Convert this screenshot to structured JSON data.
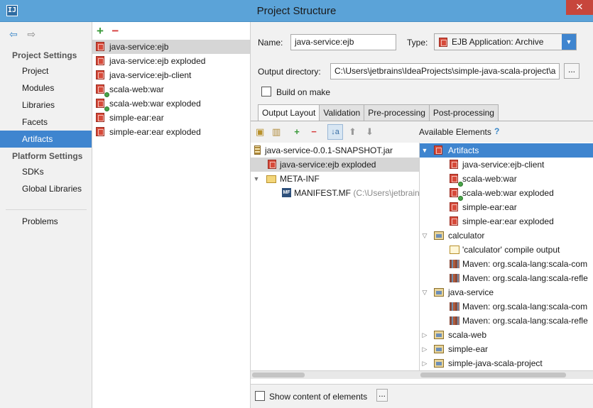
{
  "window": {
    "title": "Project Structure",
    "app_icon": "IJ",
    "close_glyph": "✕"
  },
  "nav": {
    "back_glyph": "⇦",
    "forward_glyph": "⇨",
    "project_settings_header": "Project Settings",
    "project_items": [
      "Project",
      "Modules",
      "Libraries",
      "Facets",
      "Artifacts"
    ],
    "platform_settings_header": "Platform Settings",
    "platform_items": [
      "SDKs",
      "Global Libraries"
    ],
    "problems": "Problems",
    "selected": "Artifacts"
  },
  "artifacts_list": {
    "add_glyph": "+",
    "remove_glyph": "−",
    "items": [
      {
        "label": "java-service:ejb",
        "icon": "ejb-jar-icon",
        "selected": true
      },
      {
        "label": "java-service:ejb exploded",
        "icon": "ejb-jar-icon"
      },
      {
        "label": "java-service:ejb-client",
        "icon": "ejb-jar-icon"
      },
      {
        "label": "scala-web:war",
        "icon": "war-icon"
      },
      {
        "label": "scala-web:war exploded",
        "icon": "war-icon"
      },
      {
        "label": "simple-ear:ear",
        "icon": "ear-icon"
      },
      {
        "label": "simple-ear:ear exploded",
        "icon": "ear-icon"
      }
    ]
  },
  "form": {
    "name_label": "Name:",
    "name_value": "java-service:ejb",
    "type_label": "Type:",
    "type_value": "EJB Application: Archive",
    "output_dir_label": "Output directory:",
    "output_dir_value": "C:\\Users\\jetbrains\\IdeaProjects\\simple-java-scala-project\\a",
    "browse_glyph": "...",
    "build_on_make_label": "Build on make",
    "build_on_make_checked": false
  },
  "tabs": [
    {
      "label": "Output Layout",
      "active": true
    },
    {
      "label": "Validation"
    },
    {
      "label": "Pre-processing"
    },
    {
      "label": "Post-processing"
    }
  ],
  "layout_toolbar": {
    "add_glyph": "+",
    "remove_glyph": "−",
    "sort_glyph": "↓a",
    "up_glyph": "⬆",
    "down_glyph": "⬇"
  },
  "output_tree": [
    {
      "label": "java-service-0.0.1-SNAPSHOT.jar",
      "icon": "jar-file-icon",
      "twisty": ""
    },
    {
      "label": "java-service:ejb exploded",
      "icon": "ejb-jar-icon",
      "twisty": "",
      "selected": true
    },
    {
      "label": "META-INF",
      "icon": "folder-icon",
      "twisty": "▼"
    },
    {
      "label": "MANIFEST.MF",
      "suffix": "(C:\\Users\\jetbrains",
      "icon": "manifest-icon",
      "twisty": ""
    }
  ],
  "available": {
    "header": "Available Elements",
    "help_glyph": "?",
    "tree": [
      {
        "label": "Artifacts",
        "icon": "artifacts-icon",
        "twisty": "▼",
        "level": 0,
        "selected": true
      },
      {
        "label": "java-service:ejb-client",
        "icon": "ejb-jar-icon",
        "level": 2
      },
      {
        "label": "scala-web:war",
        "icon": "war-icon",
        "level": 2
      },
      {
        "label": "scala-web:war exploded",
        "icon": "war-icon",
        "level": 2
      },
      {
        "label": "simple-ear:ear",
        "icon": "ear-icon",
        "level": 2
      },
      {
        "label": "simple-ear:ear exploded",
        "icon": "ear-icon",
        "level": 2
      },
      {
        "label": "calculator",
        "icon": "module-icon",
        "twisty": "▽",
        "level": 0
      },
      {
        "label": "'calculator' compile output",
        "icon": "compile-output-icon",
        "level": 2
      },
      {
        "label": "Maven: org.scala-lang:scala-com",
        "icon": "library-icon",
        "level": 2
      },
      {
        "label": "Maven: org.scala-lang:scala-refle",
        "icon": "library-icon",
        "level": 2
      },
      {
        "label": "java-service",
        "icon": "module-icon",
        "twisty": "▽",
        "level": 0
      },
      {
        "label": "Maven: org.scala-lang:scala-com",
        "icon": "library-icon",
        "level": 2
      },
      {
        "label": "Maven: org.scala-lang:scala-refle",
        "icon": "library-icon",
        "level": 2
      },
      {
        "label": "scala-web",
        "icon": "module-icon",
        "twisty": "▷",
        "level": 0
      },
      {
        "label": "simple-ear",
        "icon": "module-icon",
        "twisty": "▷",
        "level": 0
      },
      {
        "label": "simple-java-scala-project",
        "icon": "module-icon",
        "twisty": "▷",
        "level": 0
      }
    ]
  },
  "bottom": {
    "show_content_label": "Show content of elements",
    "show_content_checked": false,
    "more_glyph": "..."
  },
  "colors": {
    "titlebar": "#5ba3d8",
    "selection_blue": "#3f85cf",
    "selection_grey": "#d6d6d6"
  }
}
